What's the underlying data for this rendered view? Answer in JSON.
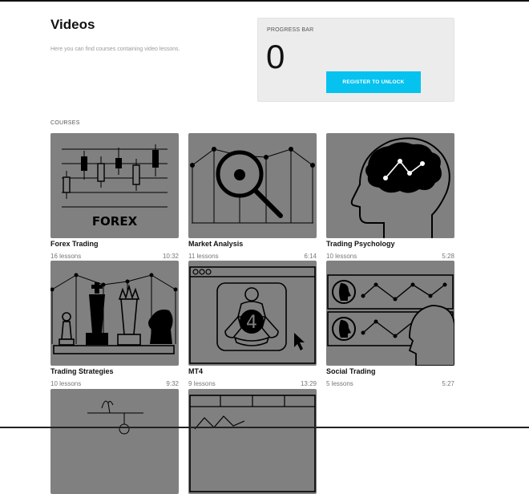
{
  "page": {
    "title": "Videos",
    "subtitle": "Here you can find courses containing video lessons."
  },
  "progress": {
    "label": "PROGRESS BAR",
    "value": "0",
    "register_label": "REGISTER TO UNLOCK"
  },
  "courses_label": "COURSES",
  "courses": [
    {
      "title": "Forex Trading",
      "lessons": "16 lessons",
      "duration": "10:32",
      "icon": "forex-candlestick-icon",
      "thumb_text": "FOREX"
    },
    {
      "title": "Market Analysis",
      "lessons": "11 lessons",
      "duration": "6:14",
      "icon": "magnifier-chart-icon"
    },
    {
      "title": "Trading Psychology",
      "lessons": "10 lessons",
      "duration": "5:28",
      "icon": "head-brain-icon"
    },
    {
      "title": "Trading Strategies",
      "lessons": "10 lessons",
      "duration": "9:32",
      "icon": "chess-pieces-icon"
    },
    {
      "title": "MT4",
      "lessons": "9 lessons",
      "duration": "13:29",
      "icon": "mt4-window-icon",
      "thumb_text": "4"
    },
    {
      "title": "Social Trading",
      "lessons": "5 lessons",
      "duration": "5:27",
      "icon": "social-trading-icon"
    },
    {
      "title": "",
      "lessons": "",
      "duration": "",
      "icon": "scale-chart-icon"
    },
    {
      "title": "",
      "lessons": "",
      "duration": "",
      "icon": "window-chart-icon"
    }
  ],
  "colors": {
    "accent": "#05c2ef",
    "thumb_bg": "#808080",
    "card_bg": "#ececec"
  }
}
